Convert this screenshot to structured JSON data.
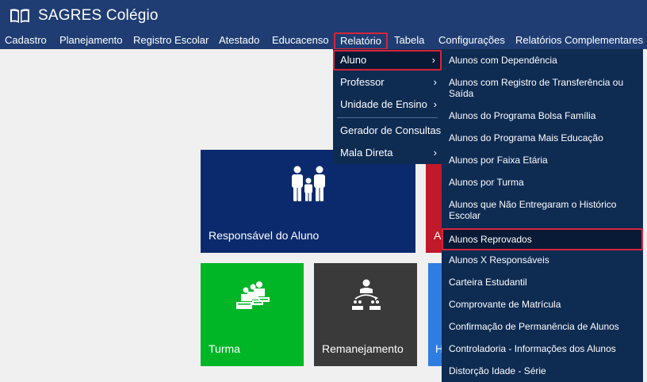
{
  "app": {
    "title": "SAGRES Colégio"
  },
  "menubar": {
    "items": [
      "Cadastro",
      "Planejamento",
      "Registro Escolar",
      "Atestado",
      "Educacenso",
      "Relatório",
      "Tabela",
      "Configurações",
      "Relatórios Complementares"
    ]
  },
  "relatorio_menu": {
    "items": [
      "Aluno",
      "Professor",
      "Unidade de Ensino",
      "Gerador de Consultas",
      "Mala Direta"
    ],
    "chevron": "›"
  },
  "aluno_submenu": {
    "items": [
      "Alunos com Dependência",
      "Alunos com Registro de Transferência ou Saída",
      "Alunos do Programa Bolsa Família",
      "Alunos do Programa Mais Educação",
      "Alunos por Faixa Etária",
      "Alunos por Turma",
      "Alunos que Não Entregaram o Histórico Escolar",
      "Alunos Reprovados",
      "Alunos X Responsáveis",
      "Carteira Estudantil",
      "Comprovante de Matrícula",
      "Confirmação de Permanência de Alunos",
      "Controladoria - Informações dos Alunos",
      "Distorção Idade - Série"
    ]
  },
  "tiles": {
    "responsavel": "Responsável do Aluno",
    "red_partial": "A",
    "turma": "Turma",
    "remanejamento": "Remanejamento",
    "blue_partial": "H"
  },
  "colors": {
    "header": "#1f3d73",
    "dropdown": "#0e2b52",
    "highlight_border": "#d8243a",
    "tile_navy": "#0b2a6e",
    "tile_green": "#00b526",
    "tile_dark": "#3a3a3a"
  },
  "icons": {
    "brand": "open-book-icon",
    "responsavel": "family-icon",
    "turma": "classroom-icon",
    "remanejamento": "transfer-icon"
  }
}
